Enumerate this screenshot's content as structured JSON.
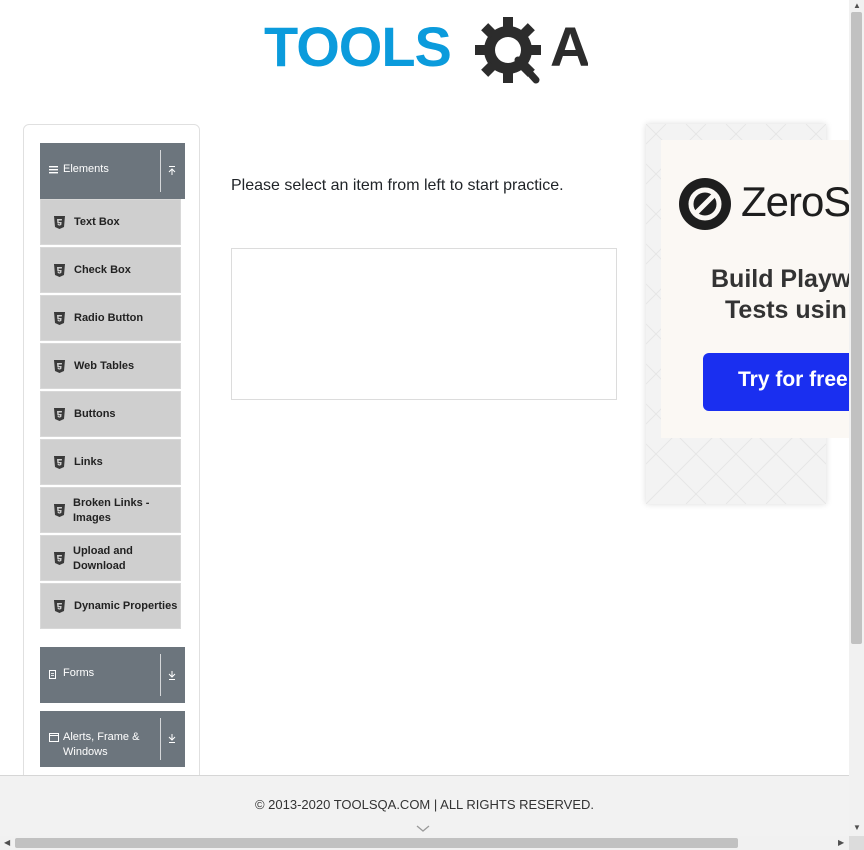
{
  "logo": {
    "part1": "TOOLS",
    "part2": "A",
    "colors": {
      "blue": "#0b9bdc",
      "dark": "#2c2c2c"
    }
  },
  "sidebar": {
    "groups": [
      {
        "label": "Elements",
        "icon": "hamburger-icon",
        "state": "expanded",
        "arrow": "collapse-arrow-icon"
      },
      {
        "label": "Forms",
        "icon": "document-icon",
        "state": "collapsed",
        "arrow": "expand-arrow-icon"
      },
      {
        "label": "Alerts, Frame &",
        "label2": "Windows",
        "icon": "window-icon",
        "state": "collapsed",
        "arrow": "expand-arrow-icon"
      }
    ],
    "items": [
      {
        "label": "Text Box",
        "icon": "html5-icon"
      },
      {
        "label": "Check Box",
        "icon": "html5-icon"
      },
      {
        "label": "Radio Button",
        "icon": "html5-icon"
      },
      {
        "label": "Web Tables",
        "icon": "html5-icon"
      },
      {
        "label": "Buttons",
        "icon": "html5-icon"
      },
      {
        "label": "Links",
        "icon": "html5-icon"
      },
      {
        "label": "Broken Links -",
        "label2": "Images",
        "icon": "html5-icon"
      },
      {
        "label": "Upload and",
        "label2": "Download",
        "icon": "html5-icon"
      },
      {
        "label": "Dynamic Properties",
        "icon": "html5-icon"
      }
    ],
    "colors": {
      "group_bg": "#6c757d",
      "item_bg": "#cfcfcf"
    }
  },
  "main": {
    "prompt": "Please select an item from left to start practice."
  },
  "ad": {
    "brand": "ZeroS",
    "headline_line1": "Build Playw",
    "headline_line2": "Tests usin",
    "cta": "Try for free",
    "cta_color": "#1a2ff0"
  },
  "footer": {
    "text": "© 2013-2020 TOOLSQA.COM | ALL RIGHTS RESERVED."
  }
}
